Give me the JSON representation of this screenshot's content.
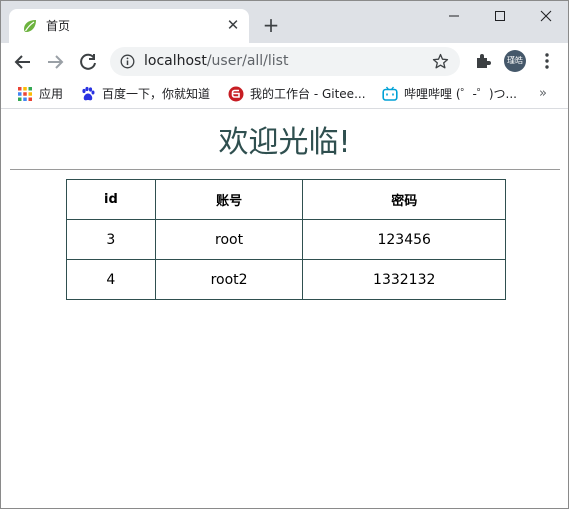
{
  "browser": {
    "tab": {
      "title": "首页",
      "favicon": "spring-leaf-icon"
    },
    "address": {
      "host": "localhost",
      "path": "/user/all/list"
    },
    "profile_label": "瑾皓",
    "bookmarks": [
      {
        "label": "应用",
        "icon": "apps-grid-icon"
      },
      {
        "label": "百度一下，你就知道",
        "icon": "baidu-paw-icon"
      },
      {
        "label": "我的工作台 - Gitee...",
        "icon": "gitee-icon"
      },
      {
        "label": "哔哩哔哩 (゜-゜)つ...",
        "icon": "bilibili-tv-icon"
      }
    ],
    "more_bookmarks": "»"
  },
  "page": {
    "heading": "欢迎光临!",
    "table": {
      "headers": [
        "id",
        "账号",
        "密码"
      ],
      "rows": [
        [
          "3",
          "root",
          "123456"
        ],
        [
          "4",
          "root2",
          "1332132"
        ]
      ]
    }
  },
  "colors": {
    "heading": "#2f4f4f",
    "table_border": "#2f4f4f",
    "tabstrip_bg": "#dee1e6",
    "omnibox_bg": "#f1f3f4"
  }
}
